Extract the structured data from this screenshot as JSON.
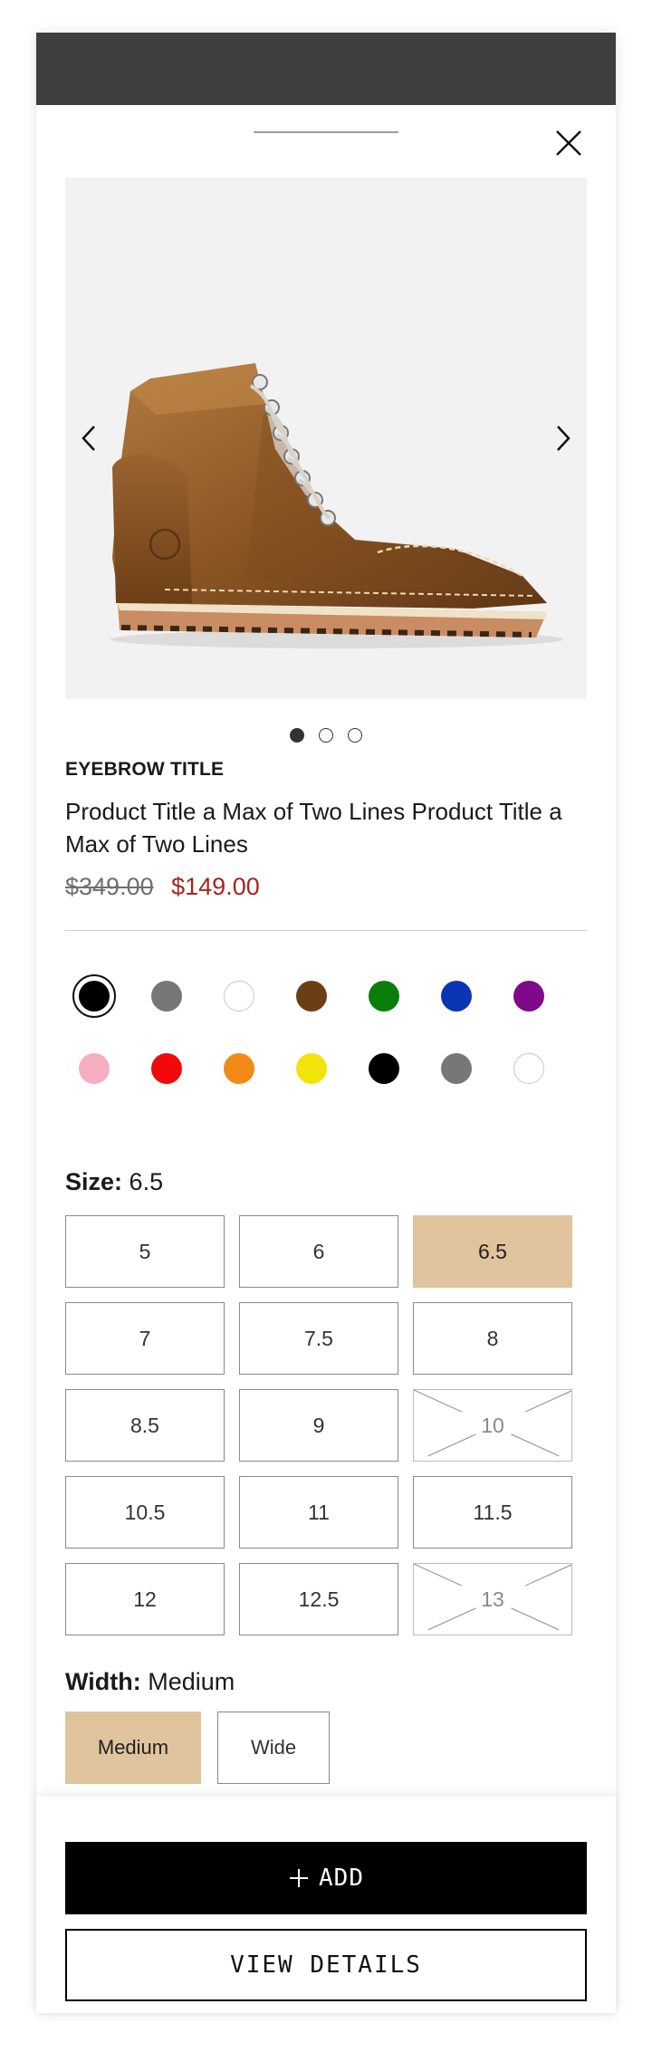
{
  "product": {
    "eyebrow": "EYEBROW TITLE",
    "title": "Product Title a Max of Two Lines Product Title a Max of Two Lines",
    "original_price": "$349.00",
    "sale_price": "$149.00",
    "image_alt": "brown leather lace-up boot"
  },
  "gallery": {
    "image_count": 3,
    "active_index": 0
  },
  "colors": [
    {
      "name": "black",
      "hex": "#000000",
      "selected": true
    },
    {
      "name": "gray",
      "hex": "#777777"
    },
    {
      "name": "white",
      "hex": "#ffffff"
    },
    {
      "name": "brown",
      "hex": "#6b3f15"
    },
    {
      "name": "green",
      "hex": "#0a7d0a"
    },
    {
      "name": "blue",
      "hex": "#0a35b5"
    },
    {
      "name": "purple",
      "hex": "#7e0a8a"
    },
    {
      "name": "pink",
      "hex": "#f7aec0"
    },
    {
      "name": "red",
      "hex": "#f20a0a"
    },
    {
      "name": "orange",
      "hex": "#f28a16"
    },
    {
      "name": "yellow",
      "hex": "#f2e30a"
    },
    {
      "name": "black",
      "hex": "#000000"
    },
    {
      "name": "gray",
      "hex": "#777777"
    },
    {
      "name": "white",
      "hex": "#ffffff"
    }
  ],
  "size": {
    "label": "Size:",
    "selected": "6.5",
    "options": [
      {
        "value": "5"
      },
      {
        "value": "6"
      },
      {
        "value": "6.5",
        "selected": true
      },
      {
        "value": "7"
      },
      {
        "value": "7.5"
      },
      {
        "value": "8"
      },
      {
        "value": "8.5"
      },
      {
        "value": "9"
      },
      {
        "value": "10",
        "unavailable": true
      },
      {
        "value": "10.5"
      },
      {
        "value": "11"
      },
      {
        "value": "11.5"
      },
      {
        "value": "12"
      },
      {
        "value": "12.5"
      },
      {
        "value": "13",
        "unavailable": true
      }
    ]
  },
  "width": {
    "label": "Width:",
    "selected": "Medium",
    "options": [
      {
        "value": "Medium",
        "selected": true
      },
      {
        "value": "Wide"
      }
    ]
  },
  "actions": {
    "add_label": "ADD",
    "view_details_label": "VIEW DETAILS"
  },
  "icons": {
    "close": "close-icon",
    "prev": "chevron-left-icon",
    "next": "chevron-right-icon",
    "add": "plus-icon"
  },
  "theme": {
    "header_bg": "#3f3f3f",
    "selected_bg": "#dfc49d",
    "sale_color": "#a3261d",
    "primary_button_bg": "#000000"
  }
}
